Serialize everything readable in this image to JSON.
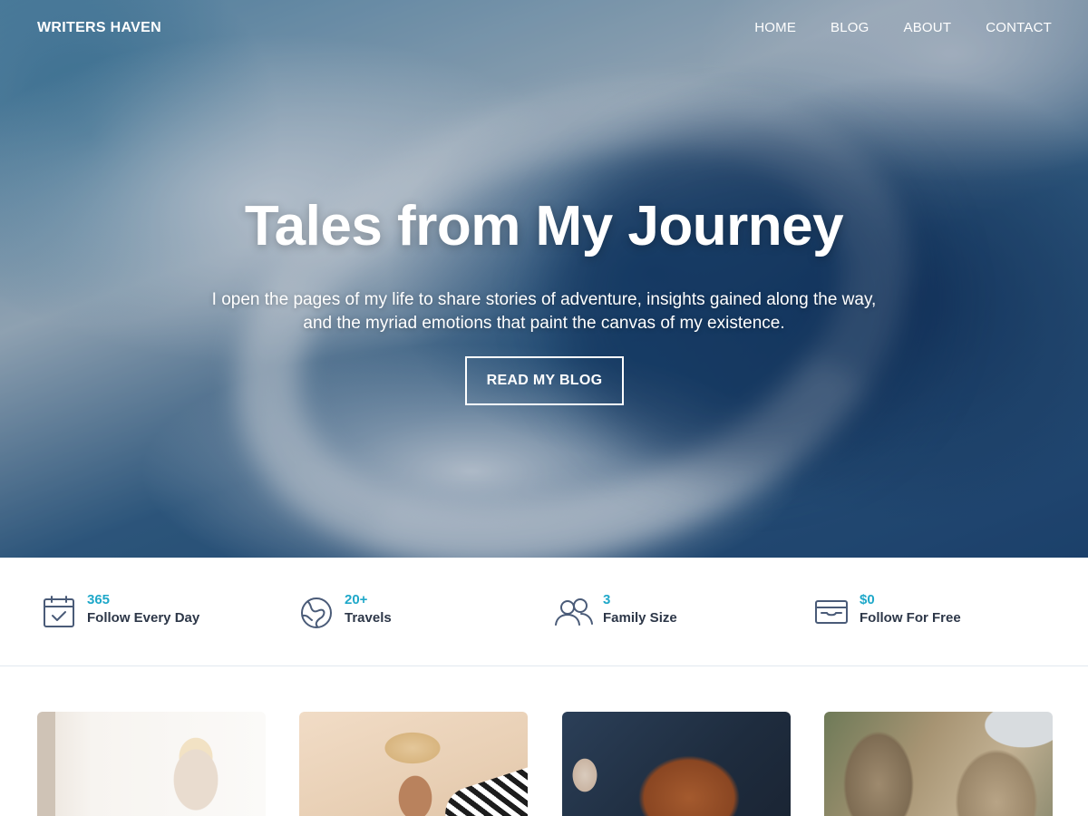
{
  "site": {
    "brand": "WRITERS HAVEN"
  },
  "nav": {
    "items": [
      {
        "label": "HOME"
      },
      {
        "label": "BLOG"
      },
      {
        "label": "ABOUT"
      },
      {
        "label": "CONTACT"
      }
    ]
  },
  "hero": {
    "title": "Tales from My Journey",
    "subtitle": "I open the pages of my life to share stories of adventure, insights gained along the way, and the myriad emotions that paint the canvas of my existence.",
    "button_label": "READ MY BLOG",
    "image": "ocean-wave-photo"
  },
  "stats": [
    {
      "value": "365",
      "label": "Follow Every Day",
      "icon": "calendar-check-icon"
    },
    {
      "value": "20+",
      "label": "Travels",
      "icon": "globe-icon"
    },
    {
      "value": "3",
      "label": "Family Size",
      "icon": "users-icon"
    },
    {
      "value": "$0",
      "label": "Follow For Free",
      "icon": "wallet-icon"
    }
  ],
  "cards": [
    {
      "image": "woman-meditating-photo"
    },
    {
      "image": "woman-sunhat-beach-photo"
    },
    {
      "image": "bread-loaf-photo"
    },
    {
      "image": "rocky-cliff-photo"
    }
  ],
  "colors": {
    "accent": "#1fa8c9",
    "text_dark": "#2d3748",
    "icon_stroke": "#4a5b78",
    "divider": "#e2e8f0"
  }
}
